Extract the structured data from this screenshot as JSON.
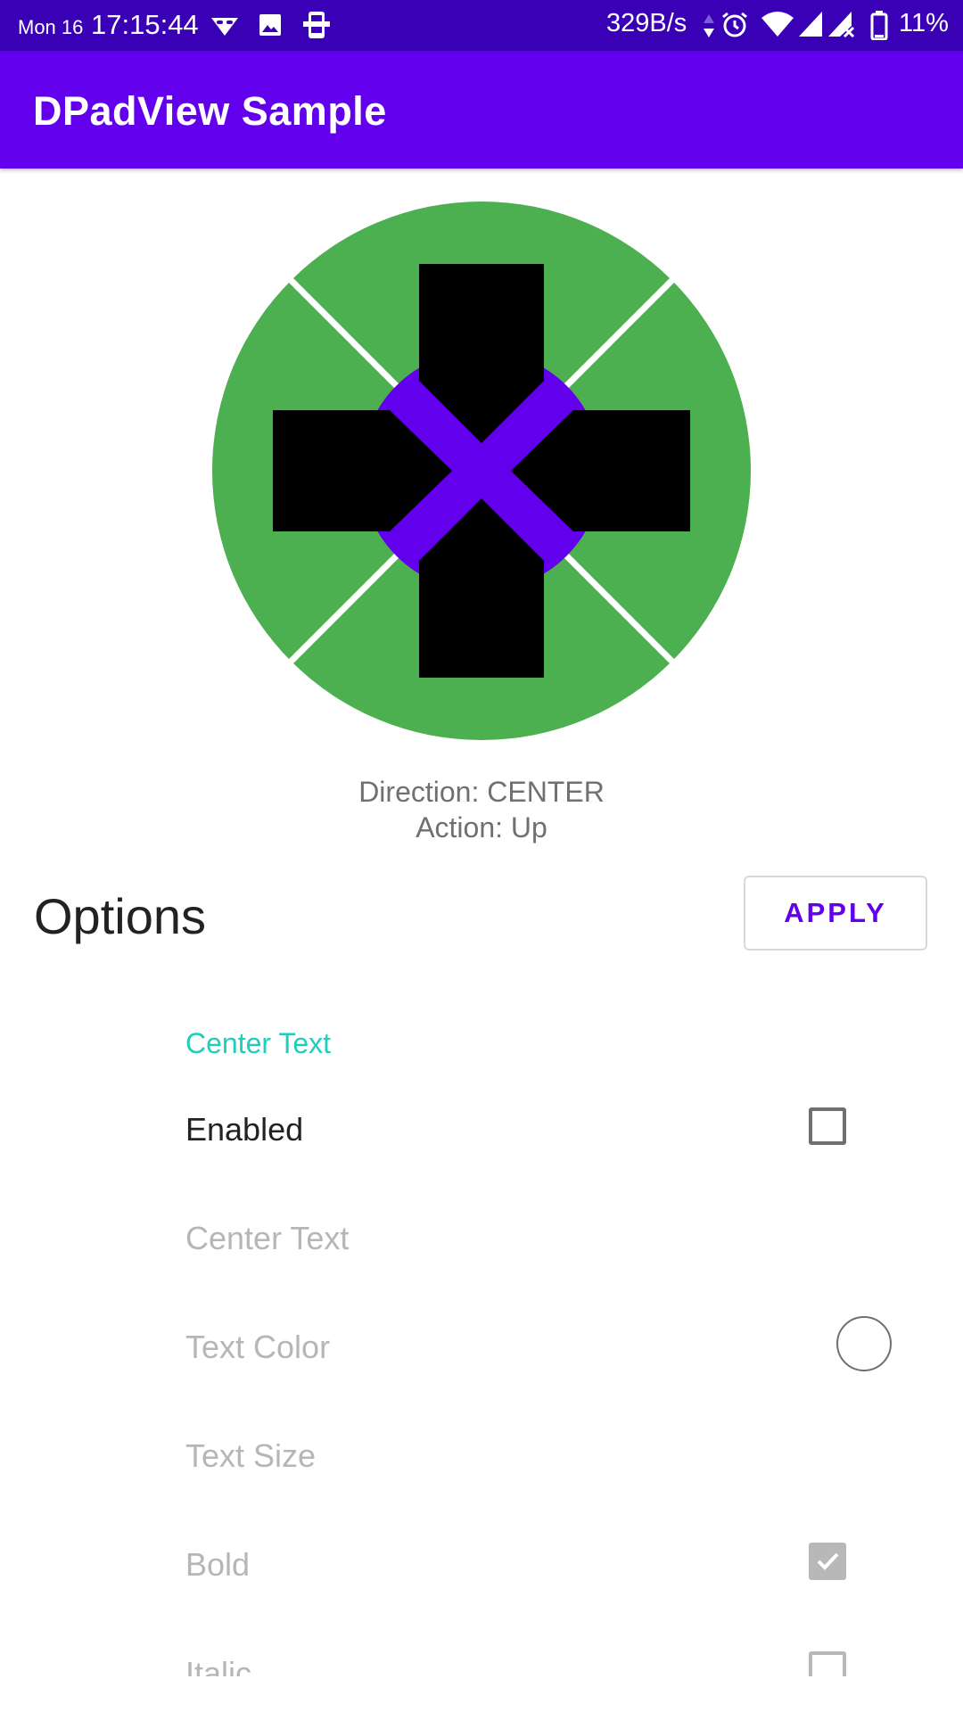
{
  "status_bar": {
    "day": "Mon 16",
    "time": "17:15:44",
    "net_speed": "329B/s",
    "battery": "11%",
    "icons": [
      "incognito-icon",
      "image-icon",
      "phone-link-icon",
      "data-arrows-icon",
      "alarm-icon",
      "wifi-icon",
      "signal-icon",
      "signal-no-data-icon",
      "battery-icon"
    ]
  },
  "app_bar": {
    "title": "DPadView Sample"
  },
  "dpad": {
    "colors": {
      "background": "#4caf50",
      "center": "#6200ee",
      "arrows": "#000000",
      "divider": "#ffffff"
    }
  },
  "readout": {
    "direction_label": "Direction:",
    "direction_value": "CENTER",
    "action_label": "Action:",
    "action_value": "Up"
  },
  "options": {
    "title": "Options",
    "apply_label": "APPLY"
  },
  "preferences": {
    "category": "Center Text",
    "enabled": {
      "label": "Enabled",
      "checked": false
    },
    "center_text": {
      "label": "Center Text"
    },
    "text_color": {
      "label": "Text Color",
      "value": "#ffffff"
    },
    "text_size": {
      "label": "Text Size"
    },
    "bold": {
      "label": "Bold",
      "checked": true
    },
    "italic": {
      "label": "Italic",
      "checked": false
    }
  },
  "colors": {
    "status_bar": "#3a00b5",
    "primary": "#6200ee",
    "accent": "#1ecfb9"
  }
}
